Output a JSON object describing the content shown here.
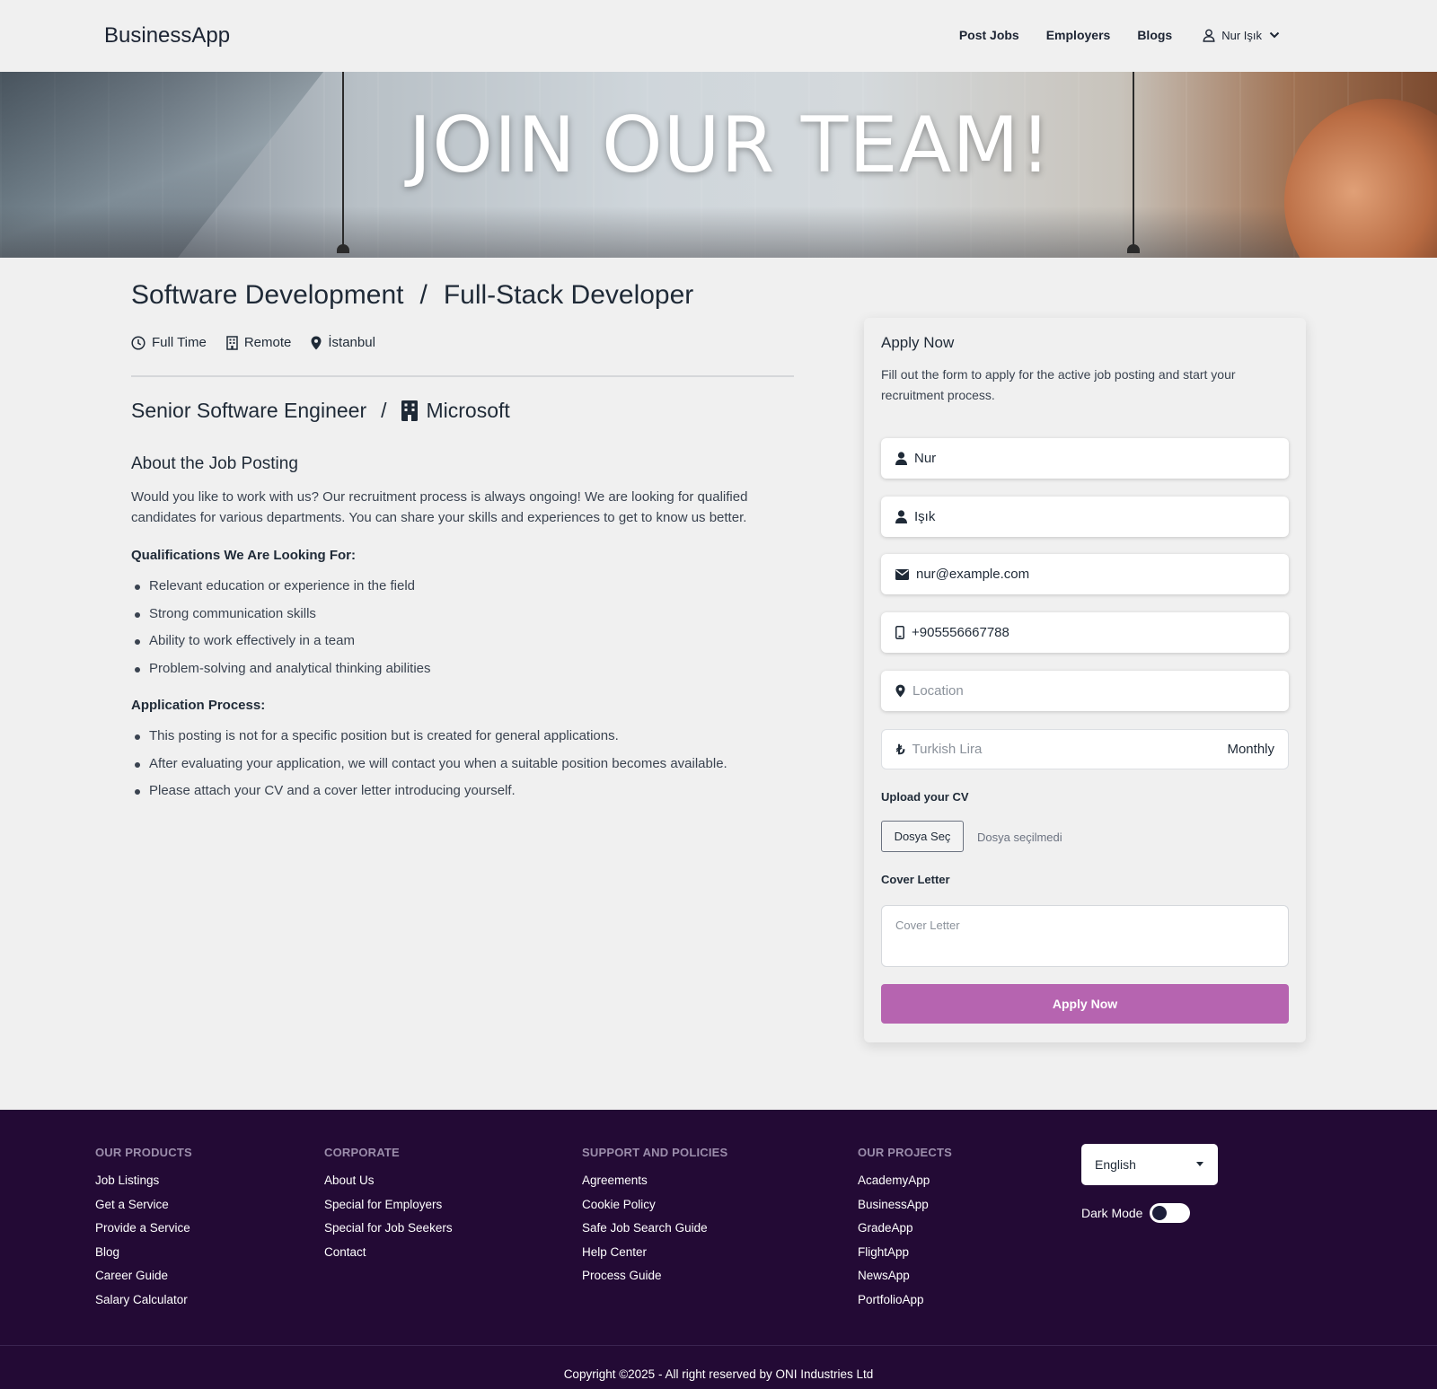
{
  "header": {
    "brand": "BusinessApp",
    "nav": [
      "Post Jobs",
      "Employers",
      "Blogs"
    ],
    "user_name": "Nur Işık"
  },
  "banner": {
    "title": "JOIN OUR TEAM!"
  },
  "job": {
    "category": "Software Development",
    "position": "Full-Stack Developer",
    "separator": "/",
    "meta": {
      "type": "Full Time",
      "mode": "Remote",
      "location": "İstanbul"
    },
    "role": "Senior Software Engineer",
    "company": "Microsoft"
  },
  "about": {
    "heading": "About the Job Posting",
    "text": "Would you like to work with us? Our recruitment process is always ongoing! We are looking for qualified candidates for various departments. You can share your skills and experiences to get to know us better.",
    "qualifications_heading": "Qualifications We Are Looking For:",
    "qualifications": [
      "Relevant education or experience in the field",
      "Strong communication skills",
      "Ability to work effectively in a team",
      "Problem-solving and analytical thinking abilities"
    ],
    "process_heading": "Application Process:",
    "process": [
      "This posting is not for a specific position but is created for general applications.",
      "After evaluating your application, we will contact you when a suitable position becomes available.",
      "Please attach your CV and a cover letter introducing yourself."
    ]
  },
  "apply": {
    "title": "Apply Now",
    "description": "Fill out the form to apply for the active job posting and start your recruitment process.",
    "first_name": "Nur",
    "last_name": "Işık",
    "email": "nur@example.com",
    "phone": "+905556667788",
    "location_placeholder": "Location",
    "salary_placeholder": "Turkish Lira",
    "salary_period": "Monthly",
    "cv_label": "Upload your CV",
    "file_button": "Dosya Seç",
    "file_state": "Dosya seçilmedi",
    "cover_label": "Cover Letter",
    "cover_placeholder": "Cover Letter",
    "submit": "Apply Now",
    "accent_color": "#b664b0"
  },
  "footer": {
    "columns": [
      {
        "title": "OUR PRODUCTS",
        "links": [
          "Job Listings",
          "Get a Service",
          "Provide a Service",
          "Blog",
          "Career Guide",
          "Salary Calculator"
        ]
      },
      {
        "title": "CORPORATE",
        "links": [
          "About Us",
          "Special for Employers",
          "Special for Job Seekers",
          "Contact"
        ]
      },
      {
        "title": "SUPPORT AND POLICIES",
        "links": [
          "Agreements",
          "Cookie Policy",
          "Safe Job Search Guide",
          "Help Center",
          "Process Guide"
        ]
      },
      {
        "title": "OUR PROJECTS",
        "links": [
          "AcademyApp",
          "BusinessApp",
          "GradeApp",
          "FlightApp",
          "NewsApp",
          "PortfolioApp"
        ]
      }
    ],
    "language": "English",
    "dark_mode_label": "Dark Mode",
    "dark_mode_on": false,
    "copyright": "Copyright ©2025 - All right reserved by ONI Industries Ltd",
    "background_color": "#230a35"
  }
}
